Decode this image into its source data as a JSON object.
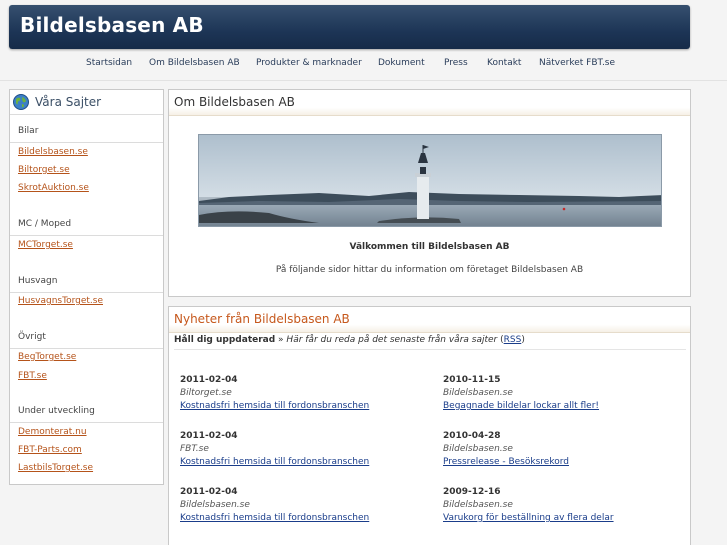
{
  "header": {
    "title": "Bildelsbasen AB"
  },
  "nav": {
    "items": [
      {
        "label": "Startsidan"
      },
      {
        "label": "Om Bildelsbasen AB"
      },
      {
        "label": "Produkter & marknader"
      },
      {
        "label": "Dokument"
      },
      {
        "label": "Press"
      },
      {
        "label": "Kontakt"
      },
      {
        "label": "Nätverket FBT.se"
      }
    ]
  },
  "sidebar": {
    "title": "Våra Sajter",
    "groups": [
      {
        "category": "Bilar",
        "links": [
          "Bildelsbasen.se",
          "Biltorget.se",
          "SkrotAuktion.se"
        ]
      },
      {
        "category": "MC / Moped",
        "links": [
          "MCTorget.se"
        ]
      },
      {
        "category": "Husvagn",
        "links": [
          "HusvagnsTorget.se"
        ]
      },
      {
        "category": "Övrigt",
        "links": [
          "BegTorget.se",
          "FBT.se"
        ]
      },
      {
        "category": "Under utveckling",
        "links": [
          "Demonterat.nu",
          "FBT-Parts.com",
          "LastbilsTorget.se"
        ]
      }
    ]
  },
  "about": {
    "title": "Om Bildelsbasen AB",
    "welcome": "Välkommen till Bildelsbasen AB",
    "intro": "På följande sidor hittar du information om företaget Bildelsbasen AB"
  },
  "news": {
    "title": "Nyheter från Bildelsbasen AB",
    "subtitle_bold": "Håll dig uppdaterad",
    "subtitle_sep": " » ",
    "subtitle_italic": "Här får du reda på det senaste från våra sajter",
    "rss_open": " (",
    "rss_label": "RSS",
    "rss_close": ")",
    "items": [
      {
        "date": "2011-02-04",
        "source": "Biltorget.se",
        "headline": "Kostnadsfri hemsida till fordonsbranschen"
      },
      {
        "date": "2010-11-15",
        "source": "Bildelsbasen.se",
        "headline": "Begagnade bildelar lockar allt fler!"
      },
      {
        "date": "2011-02-04",
        "source": "FBT.se",
        "headline": "Kostnadsfri hemsida till fordonsbranschen"
      },
      {
        "date": "2010-04-28",
        "source": "Bildelsbasen.se",
        "headline": "Pressrelease - Besöksrekord"
      },
      {
        "date": "2011-02-04",
        "source": "Bildelsbasen.se",
        "headline": "Kostnadsfri hemsida till fordonsbranschen"
      },
      {
        "date": "2009-12-16",
        "source": "Bildelsbasen.se",
        "headline": "Varukorg för beställning av flera delar"
      }
    ]
  },
  "colors": {
    "header_bg": "#1d3556",
    "link": "#b5531a",
    "news_title": "#c6581c",
    "news_link": "#1a3d8a"
  }
}
